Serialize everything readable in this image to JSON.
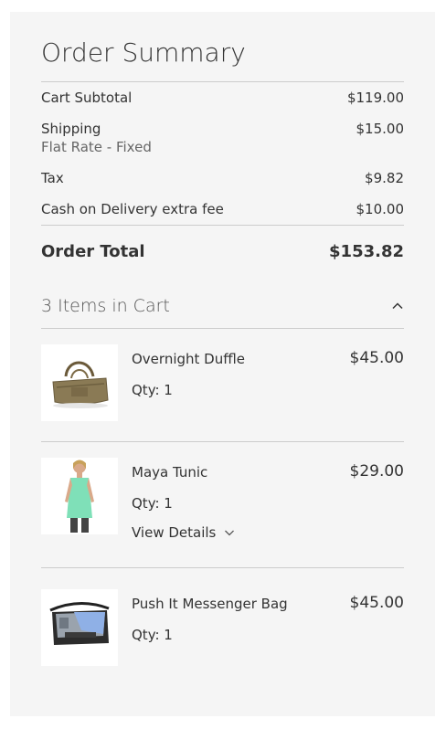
{
  "summary": {
    "title": "Order Summary",
    "lines": [
      {
        "label": "Cart Subtotal",
        "value": "$119.00"
      },
      {
        "label": "Shipping",
        "sublabel": "Flat Rate - Fixed",
        "value": "$15.00"
      },
      {
        "label": "Tax",
        "value": "$9.82"
      },
      {
        "label": "Cash on Delivery extra fee",
        "value": "$10.00"
      }
    ],
    "total_label": "Order Total",
    "total_value": "$153.82"
  },
  "cart": {
    "header": "3 Items in Cart",
    "items": [
      {
        "name": "Overnight Duffle",
        "qty": "Qty: 1",
        "price": "$45.00"
      },
      {
        "name": "Maya Tunic",
        "qty": "Qty: 1",
        "price": "$29.00",
        "details": "View Details"
      },
      {
        "name": "Push It Messenger Bag",
        "qty": "Qty: 1",
        "price": "$45.00"
      }
    ]
  }
}
